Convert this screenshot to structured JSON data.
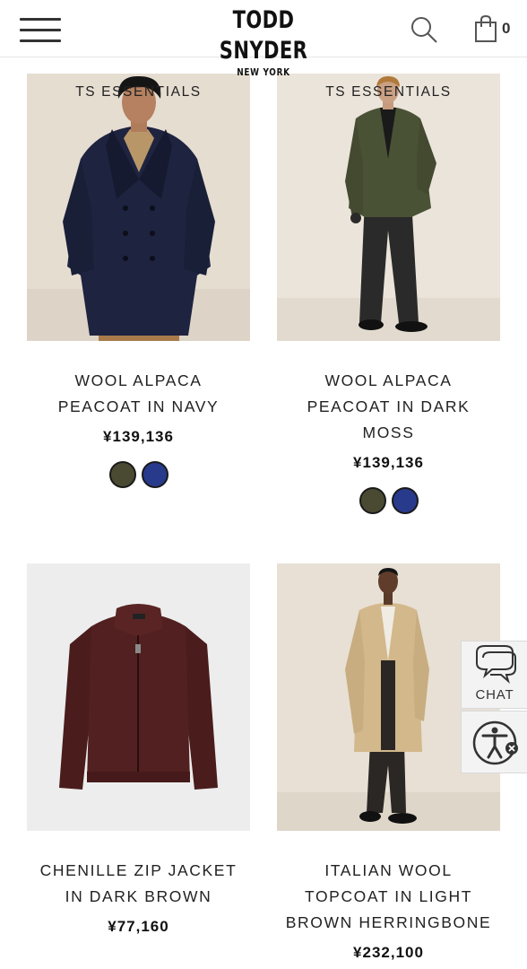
{
  "header": {
    "brand": "TODD SNYDER",
    "brand_sub": "NEW YORK",
    "cart_count": "0"
  },
  "products": [
    {
      "badge": "TS ESSENTIALS",
      "name": "WOOL ALPACA PEACOAT IN NAVY",
      "price": "¥139,136",
      "swatches": [
        "#4a4a33",
        "#283a8c"
      ],
      "image_subject": "man-in-navy-peacoat"
    },
    {
      "badge": "TS ESSENTIALS",
      "name": "WOOL ALPACA PEACOAT IN DARK MOSS",
      "price": "¥139,136",
      "swatches": [
        "#4a4a33",
        "#283a8c"
      ],
      "image_subject": "man-in-dark-moss-peacoat"
    },
    {
      "badge": "",
      "name": "CHENILLE ZIP JACKET IN DARK BROWN",
      "price": "¥77,160",
      "swatches": [],
      "image_subject": "dark-brown-zip-jacket"
    },
    {
      "badge": "",
      "name": "ITALIAN WOOL TOPCOAT IN LIGHT BROWN HERRINGBONE",
      "price": "¥232,100",
      "swatches": [],
      "image_subject": "man-in-light-brown-topcoat"
    }
  ],
  "widgets": {
    "chat_label": "CHAT"
  },
  "colors": {
    "accent_text": "#1a1a1a",
    "swatch_moss": "#4a4a33",
    "swatch_navy": "#283a8c",
    "photo_background": "#e6dfd5"
  }
}
